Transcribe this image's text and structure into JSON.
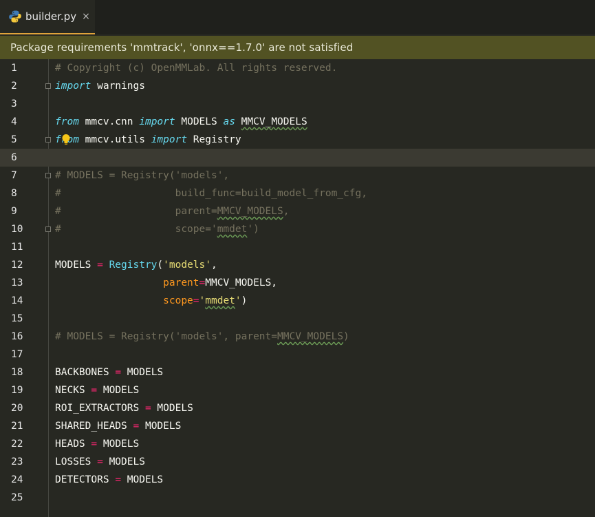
{
  "tab": {
    "filename": "builder.py",
    "close_glyph": "×",
    "icon": "python-icon"
  },
  "banner": {
    "text": "Package requirements 'mmtrack', 'onnx==1.7.0' are not satisfied"
  },
  "colors": {
    "background": "#272822",
    "keyword": "#66d9ef",
    "string": "#e6db74",
    "comment": "#75715e",
    "operator": "#f92672",
    "parameter": "#fd971f",
    "banner_bg": "#525223",
    "tab_accent": "#e0a33a"
  },
  "editor": {
    "current_line": 6,
    "lines": [
      {
        "n": "1"
      },
      {
        "n": "2"
      },
      {
        "n": "3"
      },
      {
        "n": "4"
      },
      {
        "n": "5"
      },
      {
        "n": "6"
      },
      {
        "n": "7"
      },
      {
        "n": "8"
      },
      {
        "n": "9"
      },
      {
        "n": "10"
      },
      {
        "n": "11"
      },
      {
        "n": "12"
      },
      {
        "n": "13"
      },
      {
        "n": "14"
      },
      {
        "n": "15"
      },
      {
        "n": "16"
      },
      {
        "n": "17"
      },
      {
        "n": "18"
      },
      {
        "n": "19"
      },
      {
        "n": "20"
      },
      {
        "n": "21"
      },
      {
        "n": "22"
      },
      {
        "n": "23"
      },
      {
        "n": "24"
      },
      {
        "n": "25"
      }
    ]
  },
  "code": {
    "l1": "# Copyright (c) OpenMMLab. All rights reserved.",
    "l2_kw": "import",
    "l2_rest": " warnings",
    "l4_from": "from",
    "l4_mod": " mmcv.cnn ",
    "l4_import": "import",
    "l4_name": " MODELS ",
    "l4_as": "as",
    "l4_sp": " ",
    "l4_alias": "MMCV_MODELS",
    "l5_from": "from",
    "l5_mod": " mmcv.utils ",
    "l5_import": "import",
    "l5_name": " Registry",
    "l7": "# MODELS = Registry('models',",
    "l8": "#                   build_func=build_model_from_cfg,",
    "l9_a": "#                   parent=",
    "l9_b": "MMCV_MODELS",
    "l9_c": ",",
    "l10_a": "#                   scope='",
    "l10_b": "mmdet",
    "l10_c": "')",
    "l12_a": "MODELS ",
    "l12_eq": "=",
    "l12_sp": " ",
    "l12_fn": "Registry",
    "l12_p": "(",
    "l12_str": "'models'",
    "l12_c": ",",
    "l13_ind": "                  ",
    "l13_param": "parent",
    "l13_eq": "=",
    "l13_val": "MMCV_MODELS,",
    "l14_ind": "                  ",
    "l14_param": "scope",
    "l14_eq": "=",
    "l14_q1": "'",
    "l14_val": "mmdet",
    "l14_q2": "'",
    "l14_end": ")",
    "l16_a": "# MODELS = Registry('models', parent=",
    "l16_b": "MMCV_MODELS",
    "l16_c": ")",
    "assign_eq": "=",
    "assign_rhs": " MODELS",
    "l18": "BACKBONES ",
    "l19": "NECKS ",
    "l20": "ROI_EXTRACTORS ",
    "l21": "SHARED_HEADS ",
    "l22": "HEADS ",
    "l23": "LOSSES ",
    "l24": "DETECTORS "
  }
}
